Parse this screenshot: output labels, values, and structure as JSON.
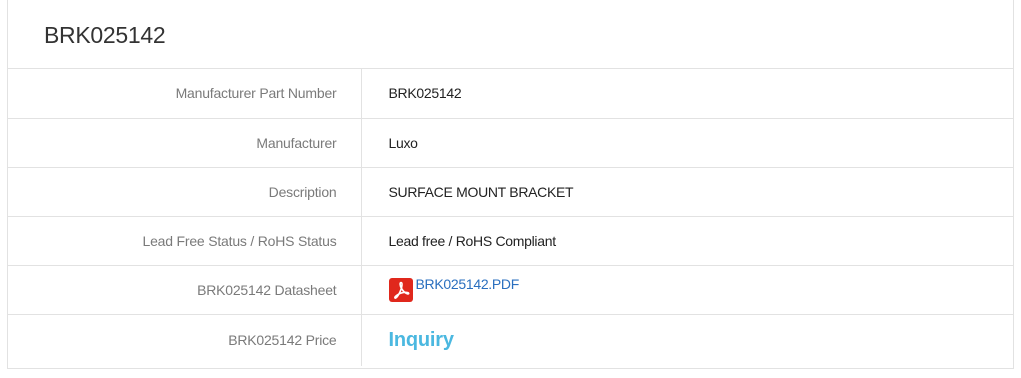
{
  "product": {
    "title": "BRK025142"
  },
  "specs": [
    {
      "label": "Manufacturer Part Number",
      "value": "BRK025142"
    },
    {
      "label": "Manufacturer",
      "value": "Luxo"
    },
    {
      "label": "Description",
      "value": "SURFACE MOUNT BRACKET"
    },
    {
      "label": "Lead Free Status / RoHS Status",
      "value": "Lead free / RoHS Compliant"
    },
    {
      "label": "BRK025142 Datasheet",
      "value": "BRK025142.PDF",
      "icon": "pdf-icon"
    },
    {
      "label": "BRK025142 Price",
      "value": "Inquiry"
    }
  ],
  "colors": {
    "border": "#e2e2e2",
    "label_text": "#7a7a7a",
    "link": "#2a6fbf",
    "inquiry": "#4bb8e0",
    "pdf_icon": "#e0281c"
  }
}
